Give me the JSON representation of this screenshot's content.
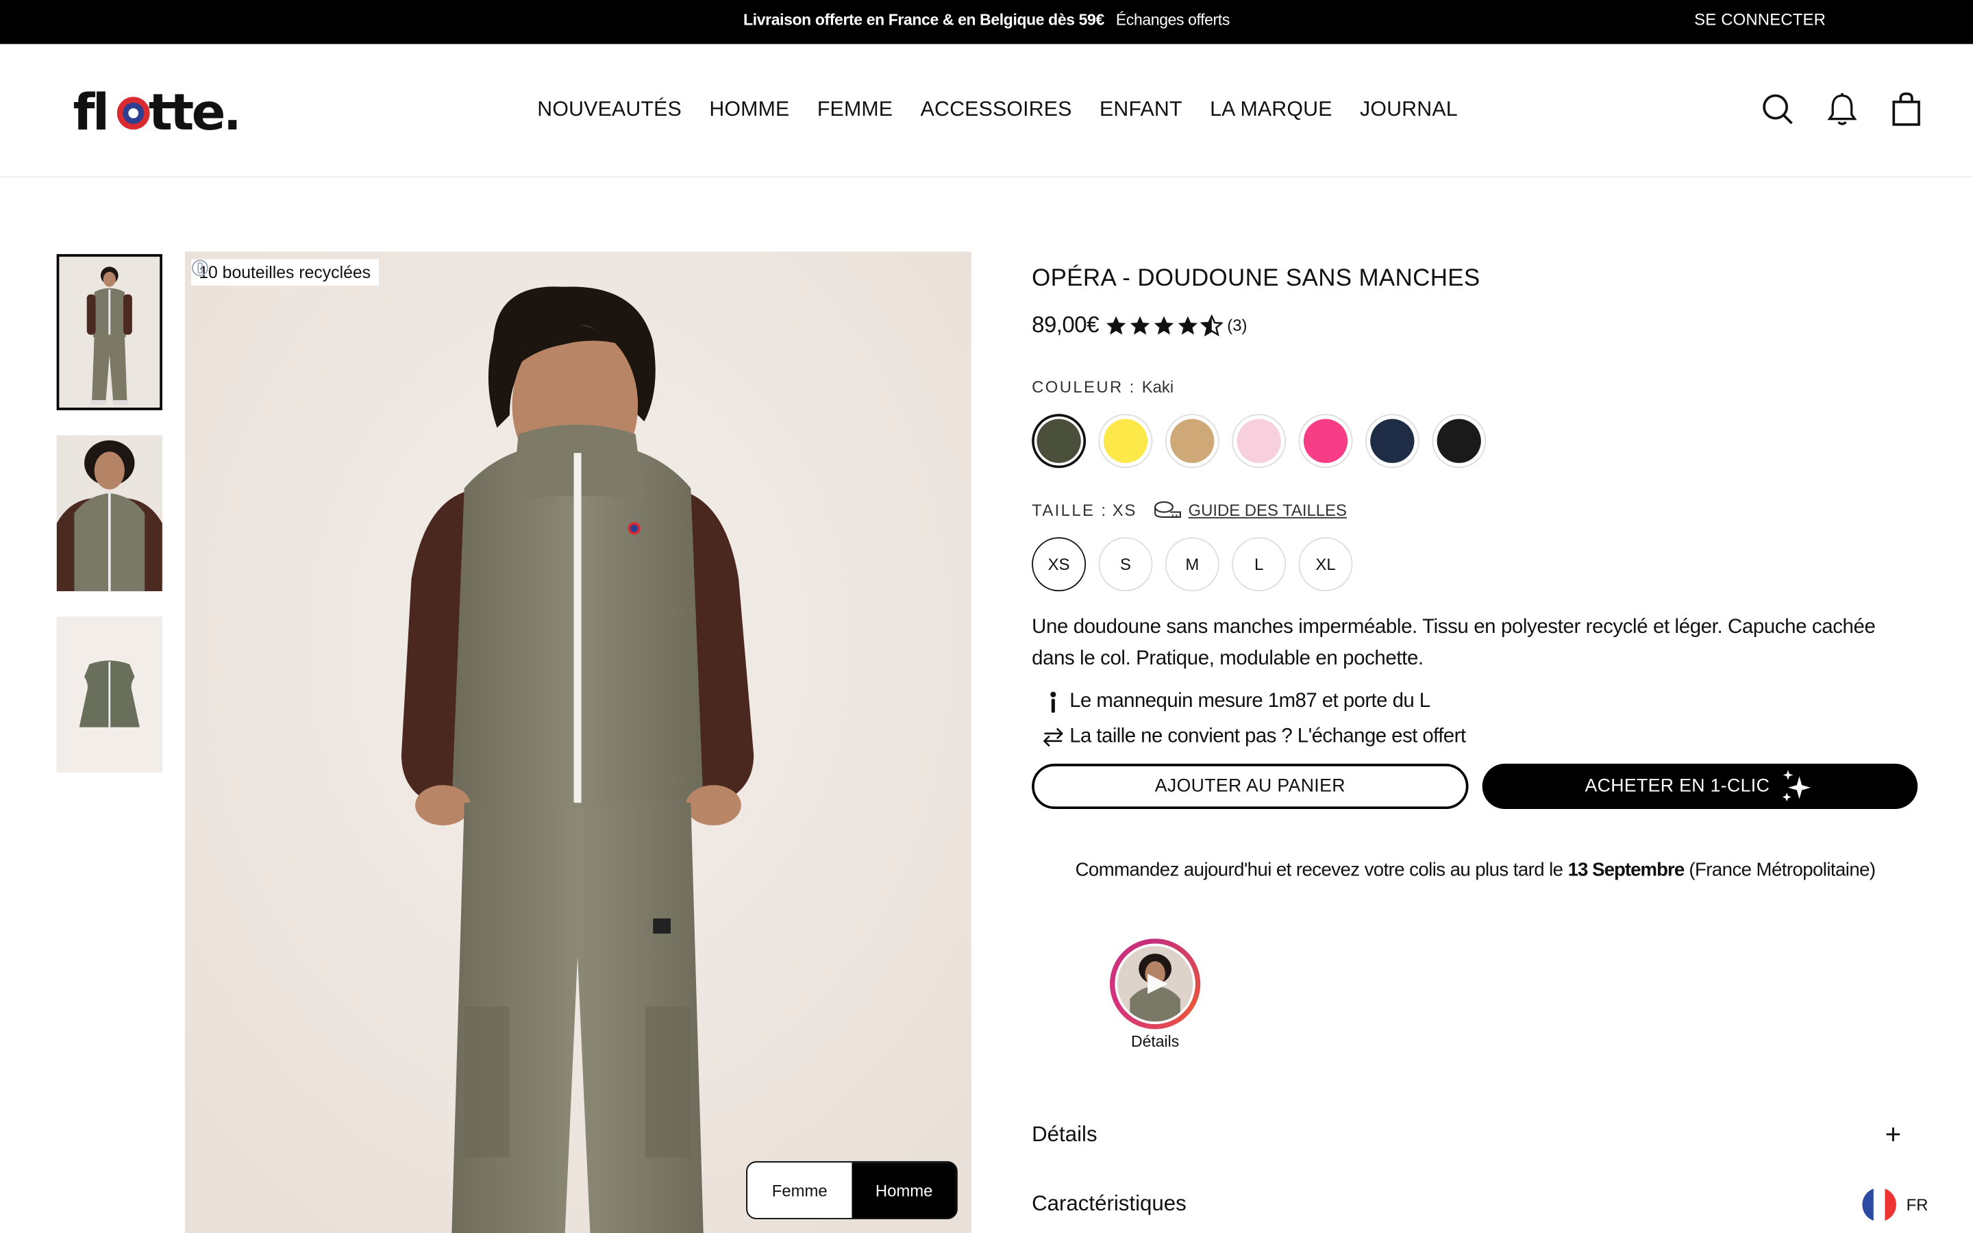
{
  "announcement": {
    "promo_bold": "Livraison offerte en France & en Belgique dès 59€",
    "promo_extra": "Échanges offerts",
    "login": "SE CONNECTER"
  },
  "header": {
    "logo_alt": "flotte.",
    "nav": [
      "NOUVEAUTÉS",
      "HOMME",
      "FEMME",
      "ACCESSOIRES",
      "ENFANT",
      "LA MARQUE",
      "JOURNAL"
    ],
    "icons": [
      "search-icon",
      "bell-icon",
      "bag-icon"
    ]
  },
  "gallery": {
    "badge": "10 bouteilles recyclées",
    "thumbnails_count": 3,
    "active_thumbnail": 1,
    "toggle": {
      "left": "Femme",
      "right": "Homme",
      "selected": "Homme"
    }
  },
  "product": {
    "title": "OPÉRA - DOUDOUNE SANS MANCHES",
    "price": "89,00€",
    "rating": 4.5,
    "review_count": "(3)",
    "color_label": "COULEUR :",
    "color_value": "Kaki",
    "swatches": [
      {
        "name": "Kaki",
        "hex": "#4a4f3c",
        "selected": true
      },
      {
        "name": "Jaune",
        "hex": "#fde84a",
        "selected": false
      },
      {
        "name": "Camel",
        "hex": "#cfa877",
        "selected": false
      },
      {
        "name": "Rose clair",
        "hex": "#f8cfdd",
        "selected": false
      },
      {
        "name": "Rose",
        "hex": "#f63d86",
        "selected": false
      },
      {
        "name": "Marine",
        "hex": "#1e2c45",
        "selected": false
      },
      {
        "name": "Noir",
        "hex": "#1b1a1b",
        "selected": false
      }
    ],
    "size_label": "TAILLE :",
    "size_value": "XS",
    "size_guide": "GUIDE DES TAILLES",
    "sizes": [
      "XS",
      "S",
      "M",
      "L",
      "XL"
    ],
    "selected_size": "XS",
    "description": "Une doudoune sans manches imperméable. Tissu en polyester recyclé et léger. Capuche cachée dans le col. Pratique, modulable en pochette.",
    "features": [
      {
        "icon": "person-icon",
        "text": "Le mannequin mesure 1m87 et porte du L"
      },
      {
        "icon": "exchange-icon",
        "text": "La taille ne convient pas ? L'échange est offert"
      }
    ],
    "add_to_cart": "AJOUTER AU PANIER",
    "buy_now": "ACHETER EN 1-CLIC",
    "delivery_prefix": "Commandez aujourd'hui et recevez votre colis au plus tard le",
    "delivery_date": "13 Septembre",
    "delivery_suffix": "(France Métropolitaine)",
    "story_label": "Détails",
    "accordion": [
      "Détails",
      "Caractéristiques"
    ]
  },
  "locale": {
    "code": "FR"
  },
  "colors": {
    "topbar": "#000000",
    "button_solid": "#000000",
    "story_ring": "#c4307b"
  }
}
